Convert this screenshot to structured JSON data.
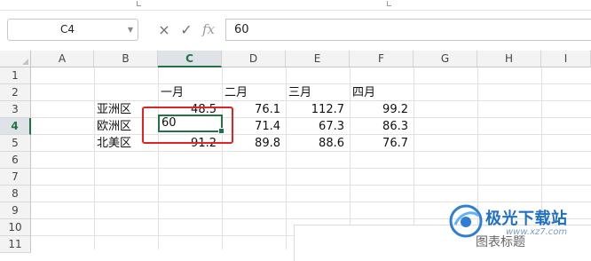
{
  "formula_bar": {
    "name_box": "C4",
    "cancel_icon": "×",
    "confirm_icon": "✓",
    "fx_label": "fx",
    "formula_value": "60"
  },
  "columns": [
    "A",
    "B",
    "C",
    "D",
    "E",
    "F",
    "G",
    "H",
    "I"
  ],
  "active_column": "C",
  "rows": [
    "1",
    "2",
    "3",
    "4",
    "5",
    "6",
    "7",
    "8",
    "9",
    "10",
    "11"
  ],
  "active_row": "4",
  "sheet": {
    "headers": [
      "一月",
      "二月",
      "三月",
      "四月"
    ],
    "regions": [
      {
        "name": "亚洲区",
        "values": [
          "48.5",
          "76.1",
          "112.7",
          "99.2"
        ]
      },
      {
        "name": "欧洲区",
        "values": [
          "60",
          "71.4",
          "67.3",
          "86.3"
        ]
      },
      {
        "name": "北美区",
        "values": [
          "91.2",
          "89.8",
          "88.6",
          "76.7"
        ]
      }
    ]
  },
  "selected_cell_value": "60",
  "chart": {
    "title": "图表标题"
  },
  "watermark": {
    "title": "极光下载站",
    "url": "www.xz7.com"
  },
  "colors": {
    "accent": "#217346",
    "highlight": "#e02424"
  }
}
